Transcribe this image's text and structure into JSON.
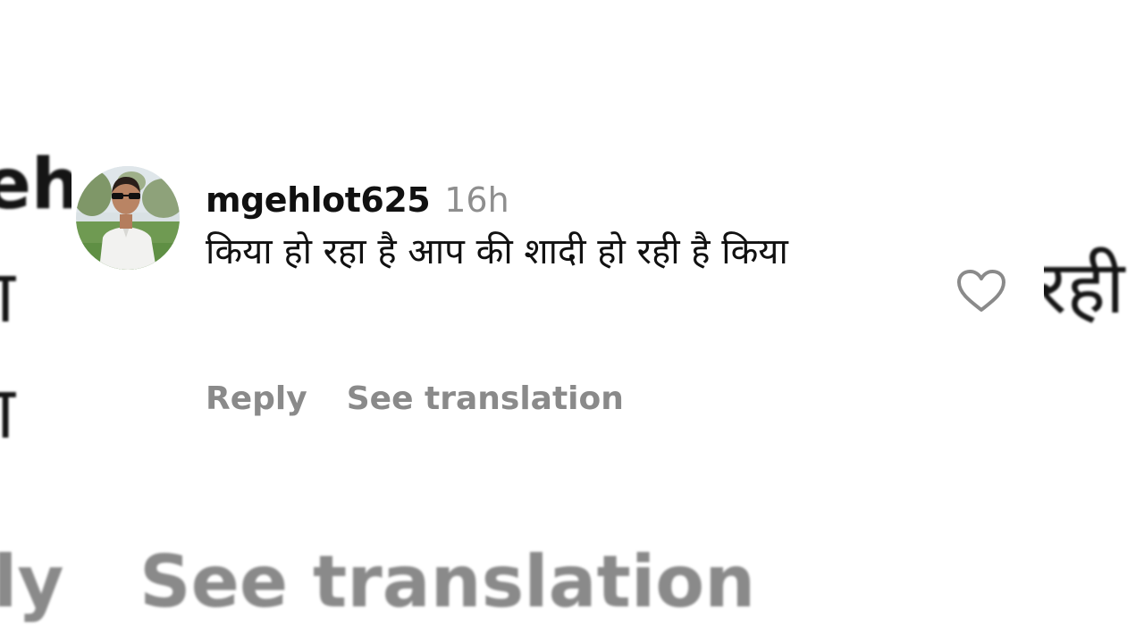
{
  "background": {
    "left_fragment_1": "eh",
    "left_fragment_2": "या",
    "left_fragment_3": "या",
    "right_fragment": "रही",
    "reply_fragment": "ly",
    "see_translation_fragment": "See translation"
  },
  "comment": {
    "username": "mgehlot625",
    "timestamp": "16h",
    "text": "किया हो रहा है आप की शादी हो रही है किया",
    "reply_label": "Reply",
    "translation_label": "See translation",
    "avatar_icon": "avatar-photo",
    "like_icon": "heart-outline-icon"
  },
  "colors": {
    "username": "#111111",
    "secondary_text": "#8e8e8e",
    "action_text": "#8a8a8a",
    "background": "#ffffff"
  }
}
